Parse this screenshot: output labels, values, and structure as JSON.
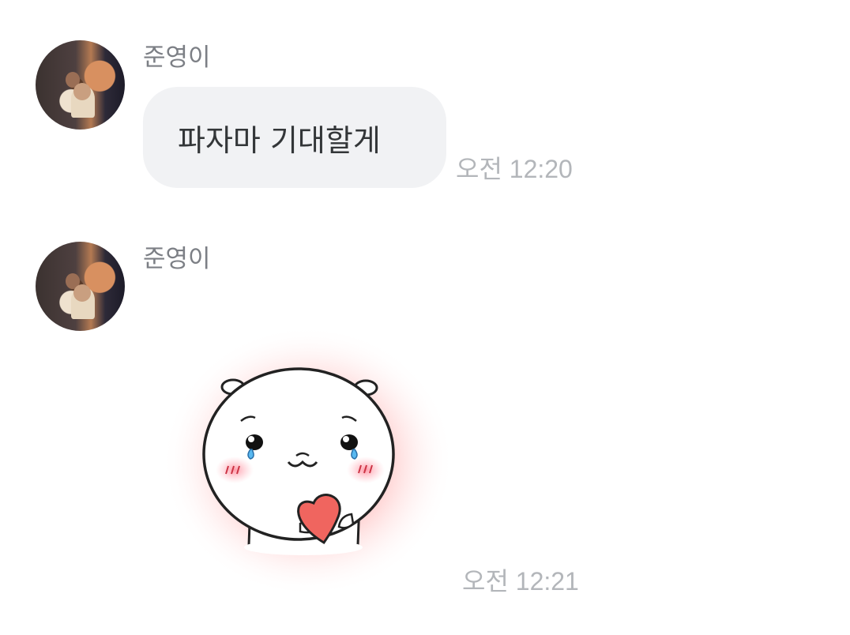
{
  "messages": [
    {
      "sender": "준영이",
      "type": "text",
      "text": "파자마 기대할게",
      "time": "오전 12:20"
    },
    {
      "sender": "준영이",
      "type": "sticker",
      "sticker_icon": "crying-bear-heart-sticker",
      "time": "오전 12:21"
    }
  ],
  "colors": {
    "bubble": "#f1f2f4",
    "sender": "#7c7f85",
    "time": "#b3b6ba",
    "text": "#333638",
    "heart": "#f0655f",
    "glow": "#ff8c8c"
  }
}
